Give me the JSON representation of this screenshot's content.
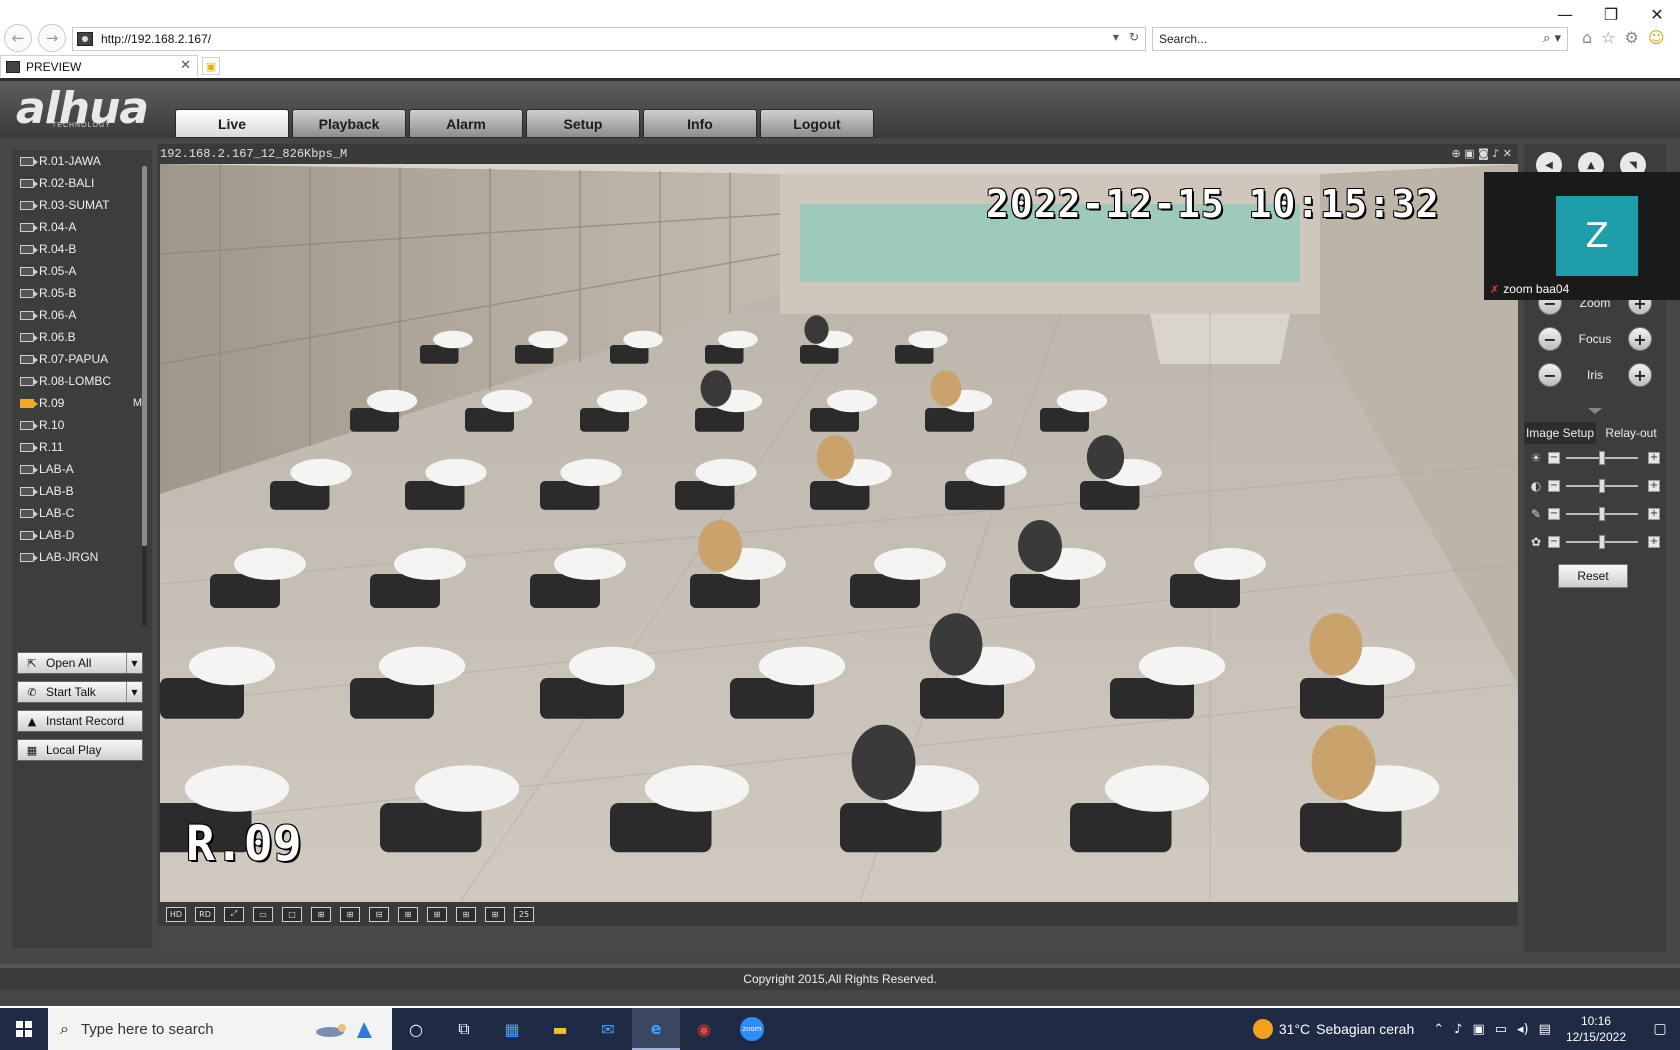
{
  "browser": {
    "window_controls": [
      "—",
      "❐",
      "✕"
    ],
    "address": "http://192.168.2.167/",
    "search_placeholder": "Search...",
    "tab_title": "PREVIEW"
  },
  "header": {
    "logo": "alhua",
    "logo_sub": "TECHNOLOGY",
    "tabs": [
      {
        "label": "Live",
        "active": true
      },
      {
        "label": "Playback",
        "active": false
      },
      {
        "label": "Alarm",
        "active": false
      },
      {
        "label": "Setup",
        "active": false
      },
      {
        "label": "Info",
        "active": false
      },
      {
        "label": "Logout",
        "active": false
      }
    ]
  },
  "channels": [
    {
      "label": "R.01-JAWA"
    },
    {
      "label": "R.02-BALI"
    },
    {
      "label": "R.03-SUMAT"
    },
    {
      "label": "R.04-A"
    },
    {
      "label": "R.04-B"
    },
    {
      "label": "R.05-A"
    },
    {
      "label": "R.05-B"
    },
    {
      "label": "R.06-A"
    },
    {
      "label": "R.06.B"
    },
    {
      "label": "R.07-PAPUA"
    },
    {
      "label": "R.08-LOMBC"
    },
    {
      "label": "R.09",
      "active": true,
      "flag": "M"
    },
    {
      "label": "R.10"
    },
    {
      "label": "R.11"
    },
    {
      "label": "LAB-A"
    },
    {
      "label": "LAB-B"
    },
    {
      "label": "LAB-C"
    },
    {
      "label": "LAB-D"
    },
    {
      "label": "LAB-JRGN"
    }
  ],
  "left_buttons": {
    "open_all": "Open All",
    "start_talk": "Start Talk",
    "instant_record": "Instant Record",
    "local_play": "Local Play"
  },
  "video": {
    "stream_title": "192.168.2.167_12_826Kbps_M",
    "osd_time": "2022-12-15 10:15:32",
    "osd_name": "R.09",
    "layout_buttons": [
      "HD",
      "RD",
      "⤢",
      "▭",
      "□",
      "⊞",
      "⊞",
      "⊟",
      "⊞",
      "⊞",
      "⊞",
      "⊞",
      "25"
    ]
  },
  "ptz": {
    "zoom_label": "Zoom",
    "focus_label": "Focus",
    "iris_label": "Iris",
    "image_setup_tab": "Image Setup",
    "relay_out_tab": "Relay-out",
    "reset_label": "Reset",
    "sliders": [
      {
        "icon": "brightness-icon",
        "value": 0.5
      },
      {
        "icon": "contrast-icon",
        "value": 0.5
      },
      {
        "icon": "saturation-icon",
        "value": 0.5
      },
      {
        "icon": "hue-icon",
        "value": 0.5
      }
    ]
  },
  "zoom_overlay": {
    "avatar_letter": "Z",
    "name": "zoom baa04",
    "avatar_color": "#1e9dab"
  },
  "footer": {
    "copyright": "Copyright 2015,All Rights Reserved."
  },
  "taskbar": {
    "search_placeholder": "Type here to search",
    "weather_temp": "31°C",
    "weather_text": "Sebagian cerah",
    "time": "10:16",
    "date": "12/15/2022"
  }
}
